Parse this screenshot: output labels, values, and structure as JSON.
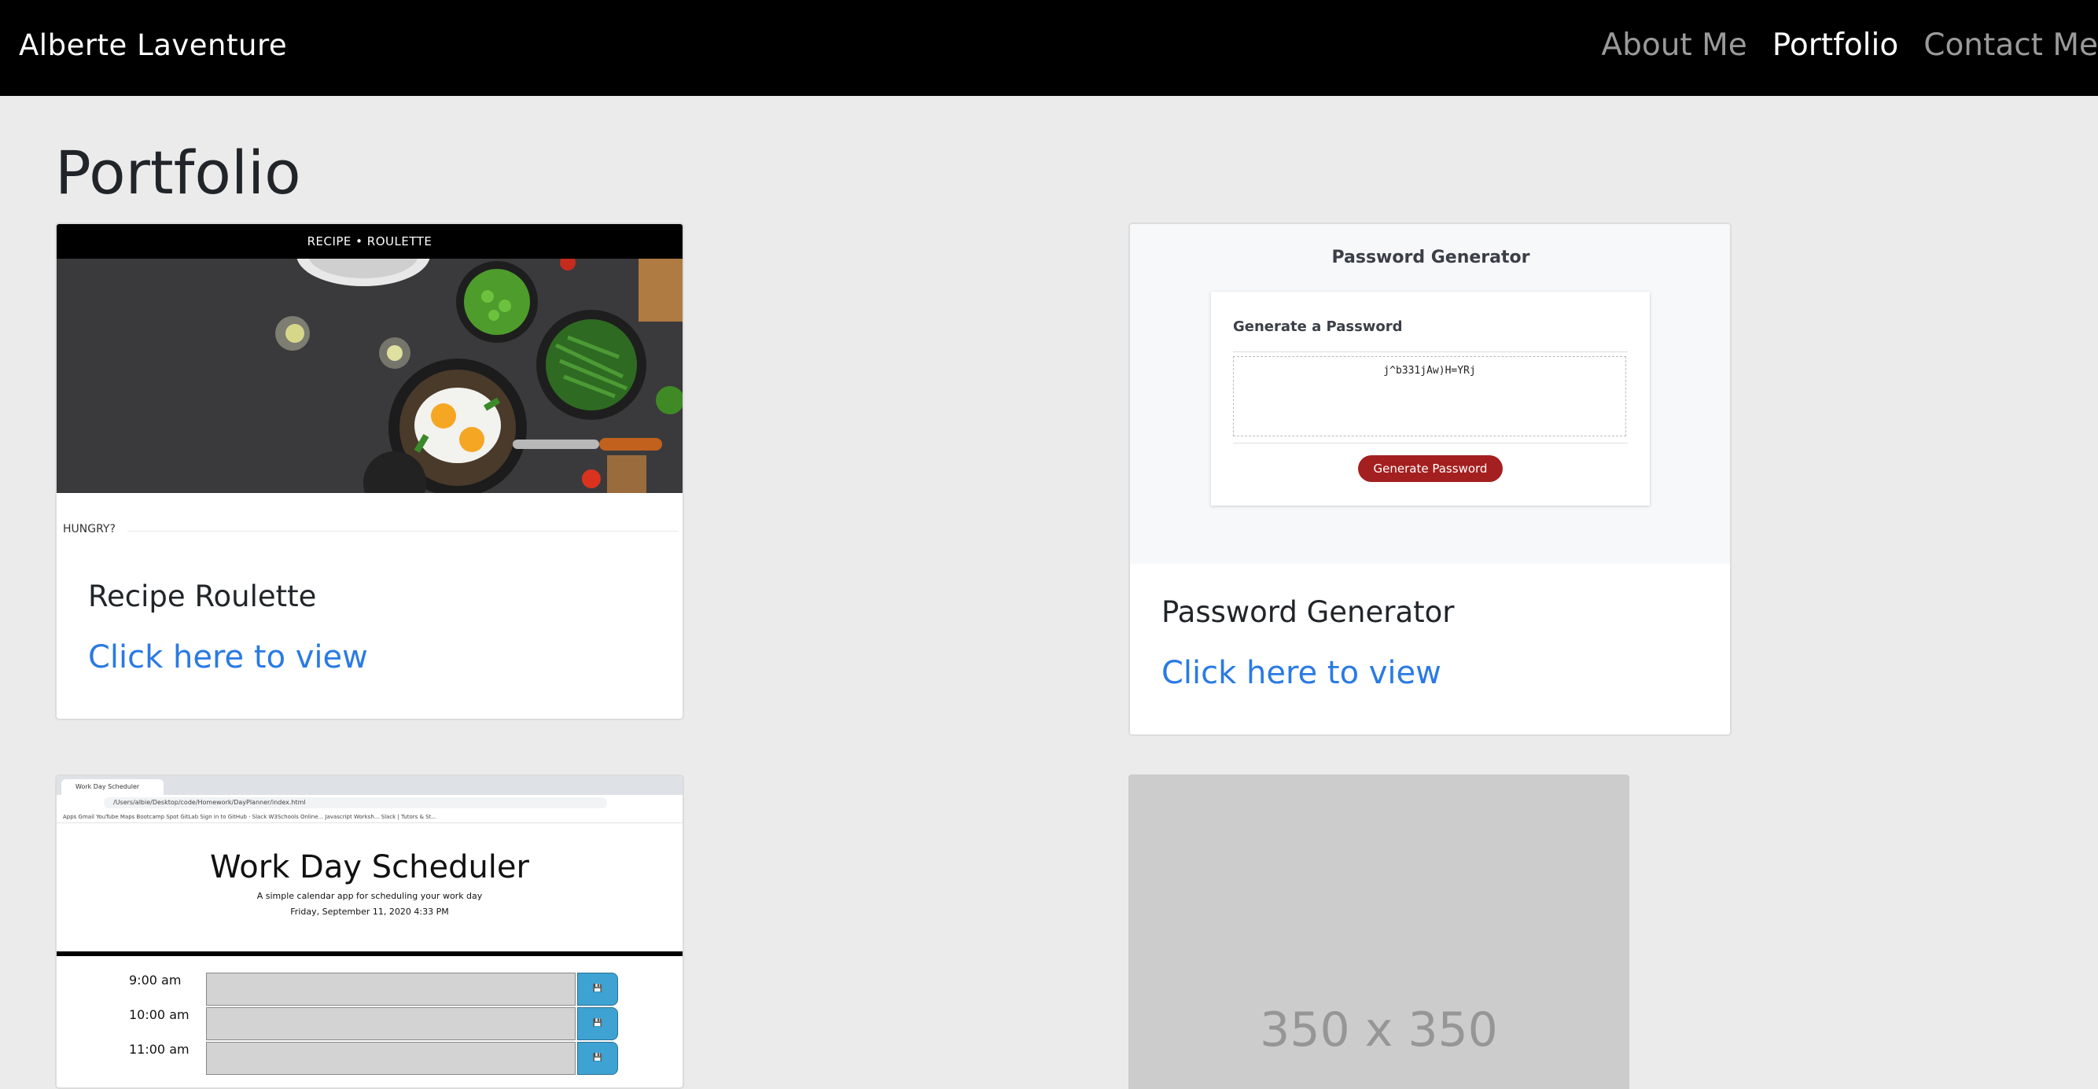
{
  "nav": {
    "brand": "Alberte Laventure",
    "links": [
      "About Me",
      "Portfolio",
      "Contact Me"
    ]
  },
  "page": {
    "title": "Portfolio"
  },
  "projects": [
    {
      "title": "Recipe Roulette",
      "link": "Click here to view",
      "preview": {
        "banner": "RECIPE • ROULETTE",
        "caption": "HUNGRY?"
      }
    },
    {
      "title": "Password Generator",
      "link": "Click here to view",
      "preview": {
        "heading": "Password Generator",
        "card_title": "Generate a Password",
        "password": "j^b331jAw)H=YRj",
        "button": "Generate Password"
      }
    },
    {
      "preview": {
        "tab": "Work Day Scheduler",
        "url": "/Users/albie/Desktop/code/Homework/DayPlanner/index.html",
        "bookmarks": "Apps   Gmail   YouTube   Maps   Bootcamp Spot   GitLab   Sign in to GitHub ·   Slack   W3Schools Online...   Javascript Worksh...   Slack | Tutors & St...",
        "title": "Work Day Scheduler",
        "subtitle": "A simple calendar app for scheduling your work day",
        "date": "Friday, September 11, 2020 4:33 PM",
        "hours": [
          "9:00 am",
          "10:00 am",
          "11:00 am"
        ]
      }
    },
    {
      "placeholder": "350 x 350"
    }
  ],
  "colors": {
    "nav_bg": "#000000",
    "link": "#2a7ae4",
    "page_bg": "#ebebeb",
    "button": "#a41f1f"
  }
}
